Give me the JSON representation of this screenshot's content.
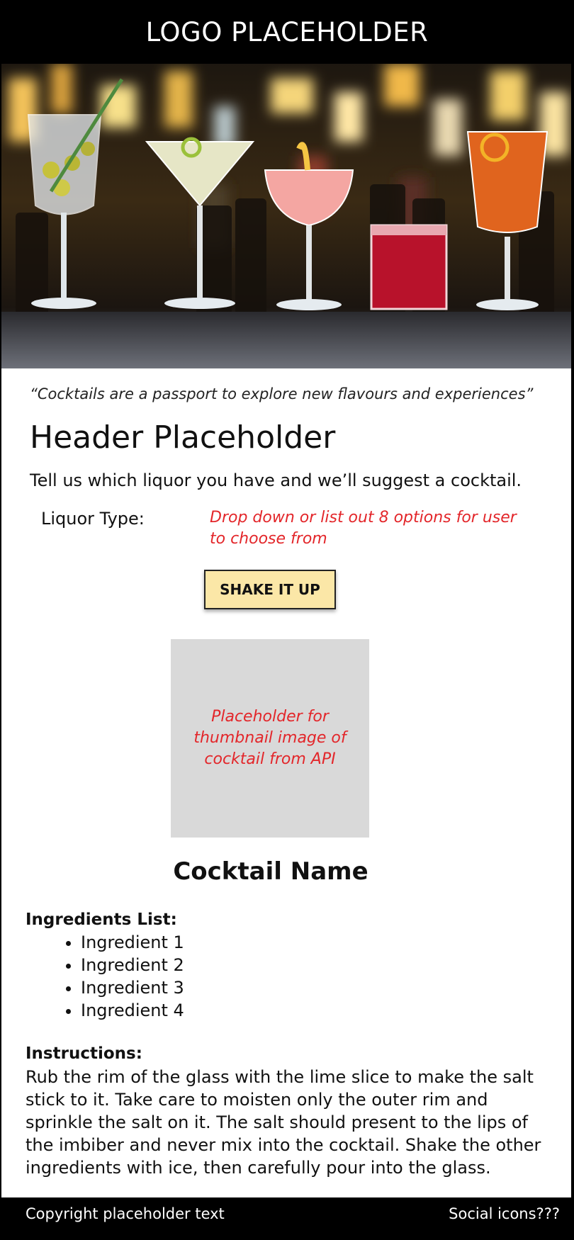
{
  "header": {
    "logo_text": "LOGO PLACEHOLDER"
  },
  "hero": {
    "image_name": "cocktails-hero-photo"
  },
  "quote": "“Cocktails are a passport to explore new flavours and experiences”",
  "main": {
    "title": "Header Placeholder",
    "lead": "Tell us which liquor you have and we’ll suggest a cocktail.",
    "liquor_label": "Liquor Type:",
    "liquor_note": "Drop down or list out 8 options for user to choose from",
    "button_label": "SHAKE IT UP",
    "thumbnail_note": "Placeholder for thumbnail image of cocktail from API",
    "cocktail_name": "Cocktail Name",
    "ingredients_title": "Ingredients List:",
    "ingredients": [
      "Ingredient 1",
      "Ingredient 2",
      "Ingredient 3",
      "Ingredient 4"
    ],
    "instructions_title": "Instructions:",
    "instructions": "Rub the rim of the glass with the lime slice to make the salt stick to it. Take care to moisten only the outer rim and sprinkle the salt on it. The salt should present to the lips of the imbiber and never mix into the cocktail. Shake the other ingredients with ice, then carefully pour into the glass."
  },
  "footer": {
    "copyright": "Copyright placeholder text",
    "social": "Social icons???"
  },
  "colors": {
    "header_bg": "#000000",
    "button_bg": "#fbe7a7",
    "placeholder_note": "#e3262a",
    "thumbnail_bg": "#d9d9d9"
  }
}
